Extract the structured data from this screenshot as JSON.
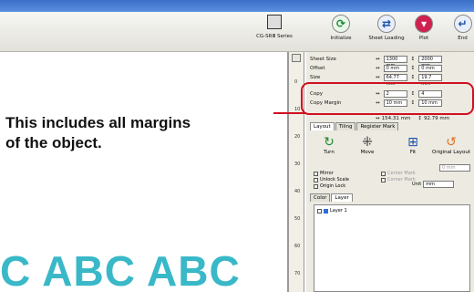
{
  "app": {
    "model": "CG-SRⅢ Series"
  },
  "toolbar": {
    "initialize": "Initialize",
    "sheet_loading": "Sheet Loading",
    "plot": "Plot",
    "end": "End"
  },
  "colors": {
    "accent_red": "#d01020",
    "abc_teal": "#39b8c8"
  },
  "properties": {
    "sheet_size": {
      "label": "Sheet Size",
      "w": "1300 mm",
      "h": "2000 mm"
    },
    "offset": {
      "label": "Offset",
      "x": "0 mm",
      "y": "0 mm"
    },
    "size": {
      "label": "Size",
      "w": "64.77 mm",
      "h": "19.7 mm"
    },
    "copy": {
      "label": "Copy",
      "x": "2",
      "y": "4"
    },
    "copy_margin": {
      "label": "Copy Margin",
      "x": "10 mm",
      "y": "10 mm"
    },
    "totals": {
      "w": "154.31 mm",
      "h": "92.79 mm"
    }
  },
  "tabs": {
    "layout": "Layout",
    "tiling": "Tiling",
    "register_mark": "Register Mark"
  },
  "layout": {
    "turn": "Turn",
    "move": "Move",
    "fit": "Fit",
    "original_layout": "Original Layout",
    "mirror": "Mirror",
    "unlock_scale": "Unlock Scale",
    "origin_lock": "Origin Lock",
    "center_mark": "Center Mark",
    "corner_mark": "Corner Mark",
    "corner_value": "0 mm",
    "unit_label": "Unit",
    "unit_value": "mm"
  },
  "color_layer": {
    "color_tab": "Color",
    "layer_tab": "Layer",
    "layer1": "Layer 1"
  },
  "canvas": {
    "text": "C ABC ABC"
  },
  "ruler": {
    "ticks": [
      "0",
      "10",
      "20",
      "30",
      "40",
      "50",
      "60",
      "70"
    ]
  },
  "annotation": {
    "line1": "This includes all margins",
    "line2": "of the object."
  }
}
